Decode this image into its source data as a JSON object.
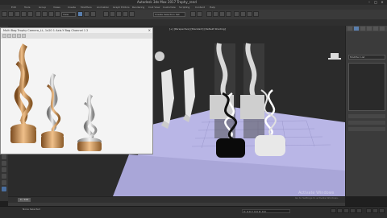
{
  "window": {
    "title": "Autodesk 3ds Max 2017   Trophy_rend",
    "min_icon": "minimize-icon",
    "max_icon": "maximize-icon",
    "close_icon": "close-icon"
  },
  "menu": [
    "Edit",
    "Tools",
    "Group",
    "Views",
    "Create",
    "Modifiers",
    "Animation",
    "Graph Editors",
    "Rendering",
    "Civil View",
    "Customize",
    "Scripting",
    "Content",
    "Help"
  ],
  "toolbar": {
    "selection_set": "Create Selection Set",
    "view_dropdown": "View"
  },
  "render_window": {
    "title": "Multi Bag Trophy Camera_LL, 1x20 1 Axis-Y Bag Channel 1 2",
    "close_label": "×"
  },
  "viewport": {
    "label": "[+] [Perspective] [Standard] [Default Shading]"
  },
  "command_panel": {
    "name_field": "Modifier List"
  },
  "timeline": {
    "frame": "0 / 100"
  },
  "status": {
    "selection": "None Selected",
    "coord": "X: 0.0  Y: 0.0  Z: 0.0",
    "activate_title": "Activate Windows",
    "activate_sub": "Go to Settings to activate Windows."
  },
  "colors": {
    "accent": "#5a7fae",
    "floor": "#b9b6e6",
    "render_bg": "#f4f4f4"
  }
}
